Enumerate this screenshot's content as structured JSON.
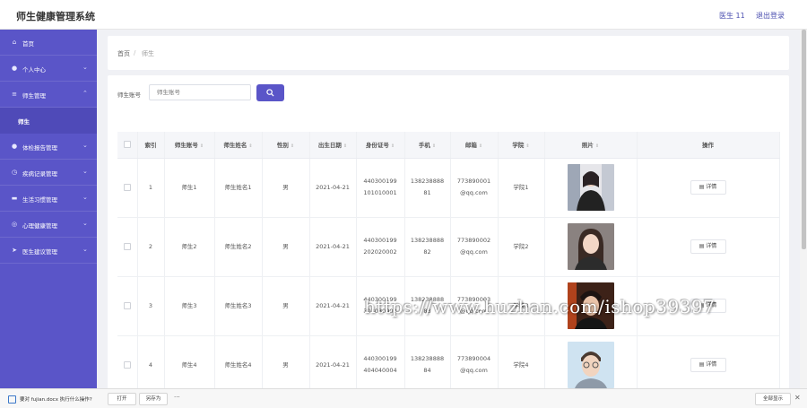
{
  "header": {
    "title": "师生健康管理系统",
    "user": "医生 11",
    "logout": "退出登录"
  },
  "sidebar": {
    "items": [
      {
        "label": "首页",
        "icon": "home-icon"
      },
      {
        "label": "个人中心",
        "icon": "user-icon"
      },
      {
        "label": "师生管理",
        "icon": "list-icon"
      },
      {
        "label": "师生",
        "icon": ""
      },
      {
        "label": "体检报告管理",
        "icon": "user-icon"
      },
      {
        "label": "疾病记录管理",
        "icon": "clock-icon"
      },
      {
        "label": "生活习惯管理",
        "icon": "chat-icon"
      },
      {
        "label": "心理健康管理",
        "icon": "globe-icon"
      },
      {
        "label": "医生建议管理",
        "icon": "send-icon"
      }
    ]
  },
  "breadcrumb": {
    "home": "首页",
    "separator": "/",
    "current": "师生"
  },
  "search": {
    "label": "师生账号",
    "placeholder": "师生账号"
  },
  "table": {
    "headers": [
      "索引",
      "师生账号",
      "师生姓名",
      "性别",
      "出生日期",
      "身份证号",
      "手机",
      "邮箱",
      "学院",
      "照片",
      "操作"
    ],
    "rows": [
      {
        "index": "1",
        "account": "师生1",
        "name": "师生姓名1",
        "gender": "男",
        "birth": "2021-04-21",
        "id1": "440300199",
        "id2": "101010001",
        "phone1": "138238888",
        "phone2": "81",
        "email1": "773890001",
        "email2": "@qq.com",
        "college": "学院1",
        "detail": "详情"
      },
      {
        "index": "2",
        "account": "师生2",
        "name": "师生姓名2",
        "gender": "男",
        "birth": "2021-04-21",
        "id1": "440300199",
        "id2": "202020002",
        "phone1": "138238888",
        "phone2": "82",
        "email1": "773890002",
        "email2": "@qq.com",
        "college": "学院2",
        "detail": "详情"
      },
      {
        "index": "3",
        "account": "师生3",
        "name": "师生姓名3",
        "gender": "男",
        "birth": "2021-04-21",
        "id1": "440300199",
        "id2": "303030003",
        "phone1": "138238888",
        "phone2": "83",
        "email1": "773890003",
        "email2": "@qq.com",
        "college": "学院3",
        "detail": "详情"
      },
      {
        "index": "4",
        "account": "师生4",
        "name": "师生姓名4",
        "gender": "男",
        "birth": "2021-04-21",
        "id1": "440300199",
        "id2": "404040004",
        "phone1": "138238888",
        "phone2": "84",
        "email1": "773890004",
        "email2": "@qq.com",
        "college": "学院4",
        "detail": "详情"
      }
    ]
  },
  "watermark": "https://www.huzhan.com/ishop39397",
  "download_bar": {
    "message": "要对 fujian.docx 执行什么操作?",
    "open": "打开",
    "save_as": "另存为",
    "more": "···",
    "show_all": "全部显示",
    "close": "✕"
  },
  "colors": {
    "primary": "#5a55c8",
    "sidebar": "#5a55c8",
    "accent_text": "#4b4fb0"
  }
}
